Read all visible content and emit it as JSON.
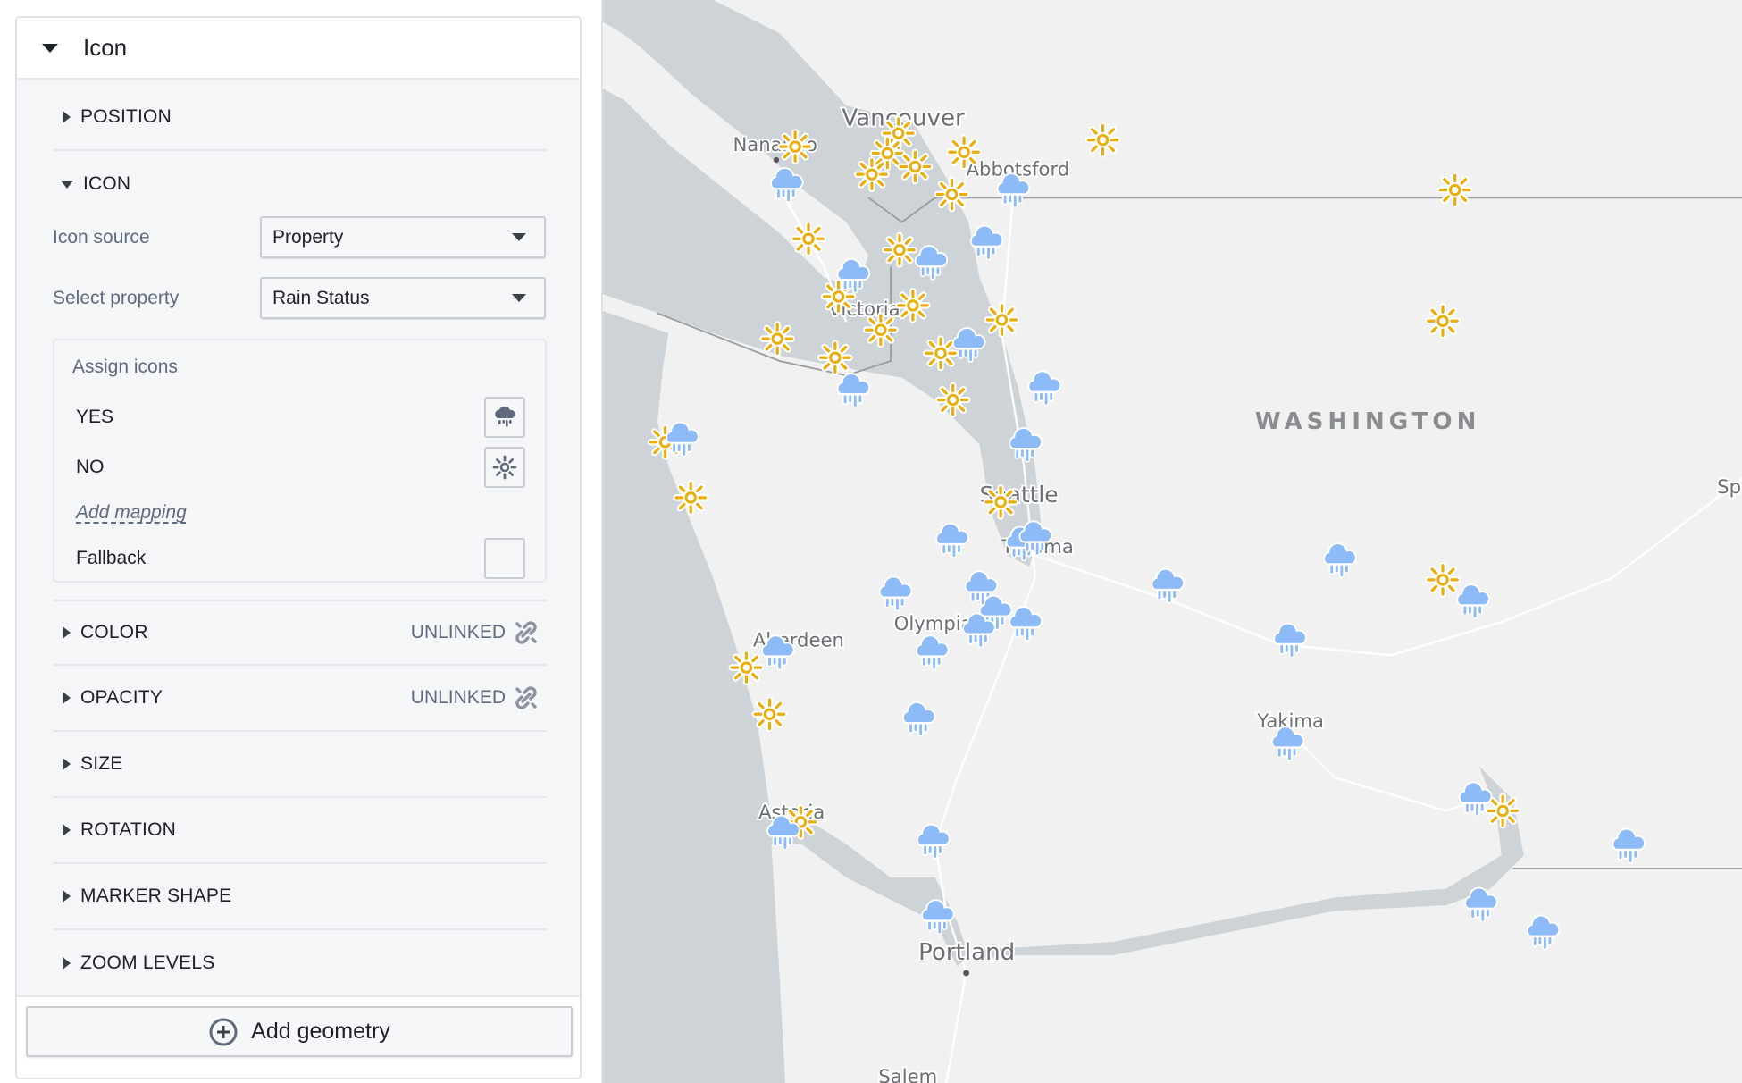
{
  "panel": {
    "header_title": "Icon",
    "sections": {
      "position": "POSITION",
      "icon": "ICON",
      "color": "COLOR",
      "opacity": "OPACITY",
      "size": "SIZE",
      "rotation": "ROTATION",
      "marker_shape": "MARKER SHAPE",
      "zoom_levels": "ZOOM LEVELS"
    },
    "unlinked_label": "UNLINKED",
    "icon_source": {
      "label": "Icon source",
      "value": "Property"
    },
    "select_property": {
      "label": "Select property",
      "value": "Rain Status"
    },
    "assign_icons": {
      "title": "Assign icons",
      "mappings": [
        {
          "value": "YES",
          "icon": "cloud-rain-icon"
        },
        {
          "value": "NO",
          "icon": "sun-icon"
        }
      ],
      "add_mapping": "Add mapping",
      "fallback": "Fallback"
    },
    "add_geometry": "Add geometry"
  },
  "map": {
    "colors": {
      "sun": "#E9AE0B",
      "rain": "#8DBBF7",
      "water": "#CDD3D6",
      "land": "#F1F1F1"
    },
    "labels": {
      "vancouver": "Vancouver",
      "nanaimo": "Nanaimo",
      "abbotsford": "Abbotsford",
      "victoria": "Victoria",
      "seattle": "Seattle",
      "tacoma": "Tacoma",
      "olympia": "Olympia",
      "aberdeen": "Aberdeen",
      "astoria": "Astoria",
      "yakima": "Yakima",
      "portland": "Portland",
      "salem": "Salem",
      "spokane": "Sp",
      "state": "WASHINGTON"
    }
  }
}
